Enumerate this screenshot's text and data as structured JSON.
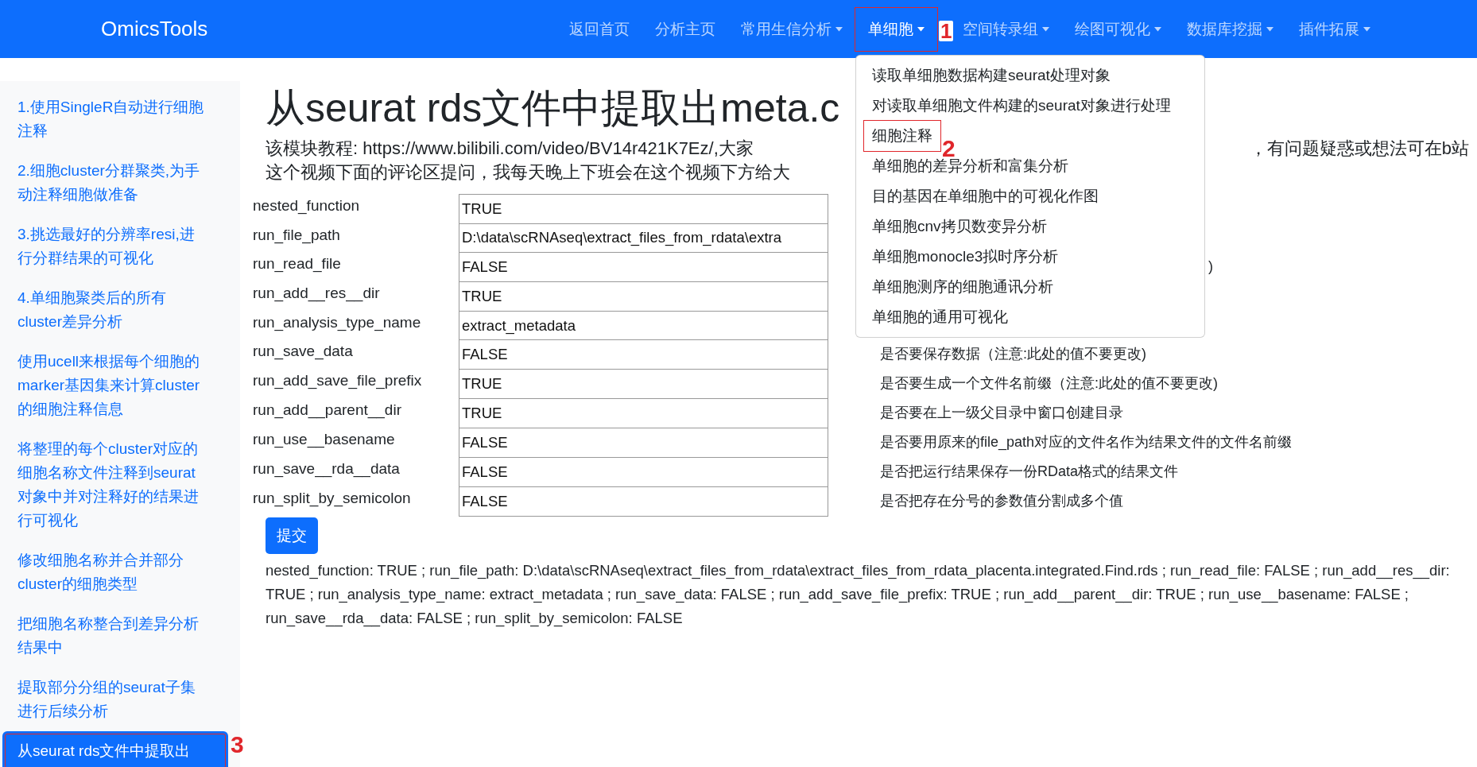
{
  "navbar": {
    "brand": "OmicsTools",
    "items": [
      {
        "label": "返回首页",
        "dropdown": false,
        "selected": false
      },
      {
        "label": "分析主页",
        "dropdown": false,
        "selected": false
      },
      {
        "label": "常用生信分析",
        "dropdown": true,
        "selected": false
      },
      {
        "label": "单细胞",
        "dropdown": true,
        "selected": true,
        "annotation": "1",
        "menu": [
          {
            "label": "读取单细胞数据构建seurat处理对象"
          },
          {
            "label": "对读取单细胞文件构建的seurat对象进行处理"
          },
          {
            "label": "细胞注释",
            "annotation": "2"
          },
          {
            "label": "单细胞的差异分析和富集分析"
          },
          {
            "label": "目的基因在单细胞中的可视化作图"
          },
          {
            "label": "单细胞cnv拷贝数变异分析"
          },
          {
            "label": "单细胞monocle3拟时序分析"
          },
          {
            "label": "单细胞测序的细胞通讯分析"
          },
          {
            "label": "单细胞的通用可视化"
          }
        ]
      },
      {
        "label": "空间转录组",
        "dropdown": true,
        "selected": false
      },
      {
        "label": "绘图可视化",
        "dropdown": true,
        "selected": false
      },
      {
        "label": "数据库挖掘",
        "dropdown": true,
        "selected": false
      },
      {
        "label": "插件拓展",
        "dropdown": true,
        "selected": false
      }
    ]
  },
  "sidebar": {
    "items": [
      {
        "label": "1.使用SingleR自动进行细胞注释",
        "selected": false
      },
      {
        "label": "2.细胞cluster分群聚类,为手动注释细胞做准备",
        "selected": false
      },
      {
        "label": "3.挑选最好的分辨率resi,进行分群结果的可视化",
        "selected": false
      },
      {
        "label": "4.单细胞聚类后的所有cluster差异分析",
        "selected": false
      },
      {
        "label": "使用ucell来根据每个细胞的marker基因集来计算cluster的细胞注释信息",
        "selected": false
      },
      {
        "label": "将整理的每个cluster对应的细胞名称文件注释到seurat对象中并对注释好的结果进行可视化",
        "selected": false
      },
      {
        "label": "修改细胞名称并合并部分cluster的细胞类型",
        "selected": false
      },
      {
        "label": "把细胞名称整合到差异分析结果中",
        "selected": false
      },
      {
        "label": "提取部分分组的seurat子集进行后续分析",
        "selected": false
      },
      {
        "label": "从seurat rds文件中提取出",
        "selected": true,
        "annotation": "3"
      }
    ]
  },
  "main": {
    "title": "从seurat rds文件中提取出meta.c",
    "description_lines": [
      {
        "left": "该模块教程: https://www.bilibili.com/video/BV14r421K7Ez/,大家",
        "right": "，有问题疑惑或想法可在b站"
      },
      {
        "left": "这个视频下面的评论区提问，我每天晚上下班会在这个视频下方给大"
      }
    ],
    "params": [
      {
        "name": "nested_function",
        "value": "TRUE"
      },
      {
        "name": "run_file_path",
        "value": "D:\\data\\scRNAseq\\extract_files_from_rdata\\extra"
      },
      {
        "name": "run_read_file",
        "value": "FALSE",
        "description_tail": ")"
      },
      {
        "name": "run_add__res__dir",
        "value": "TRUE"
      },
      {
        "name": "run_analysis_type_name",
        "value": "extract_metadata"
      },
      {
        "name": "run_save_data",
        "value": "FALSE",
        "description": "是否要保存数据（注意:此处的值不要更改)"
      },
      {
        "name": "run_add_save_file_prefix",
        "value": "TRUE",
        "description": "是否要生成一个文件名前缀（注意:此处的值不要更改)"
      },
      {
        "name": "run_add__parent__dir",
        "value": "TRUE",
        "description": "是否要在上一级父目录中窗口创建目录"
      },
      {
        "name": "run_use__basename",
        "value": "FALSE",
        "description": "是否要用原来的file_path对应的文件名作为结果文件的文件名前缀"
      },
      {
        "name": "run_save__rda__data",
        "value": "FALSE",
        "description": "是否把运行结果保存一份RData格式的结果文件"
      },
      {
        "name": "run_split_by_semicolon",
        "value": "FALSE",
        "description": "是否把存在分号的参数值分割成多个值"
      }
    ],
    "submit_label": "提交",
    "output": "nested_function: TRUE ; run_file_path: D:\\data\\scRNAseq\\extract_files_from_rdata\\extract_files_from_rdata_placenta.integrated.Find.rds ; run_read_file: FALSE ; run_add__res__dir: TRUE ; run_analysis_type_name: extract_metadata ; run_save_data: FALSE ; run_add_save_file_prefix: TRUE ; run_add__parent__dir: TRUE ; run_use__basename: FALSE ; run_save__rda__data: FALSE ; run_split_by_semicolon: FALSE"
  }
}
